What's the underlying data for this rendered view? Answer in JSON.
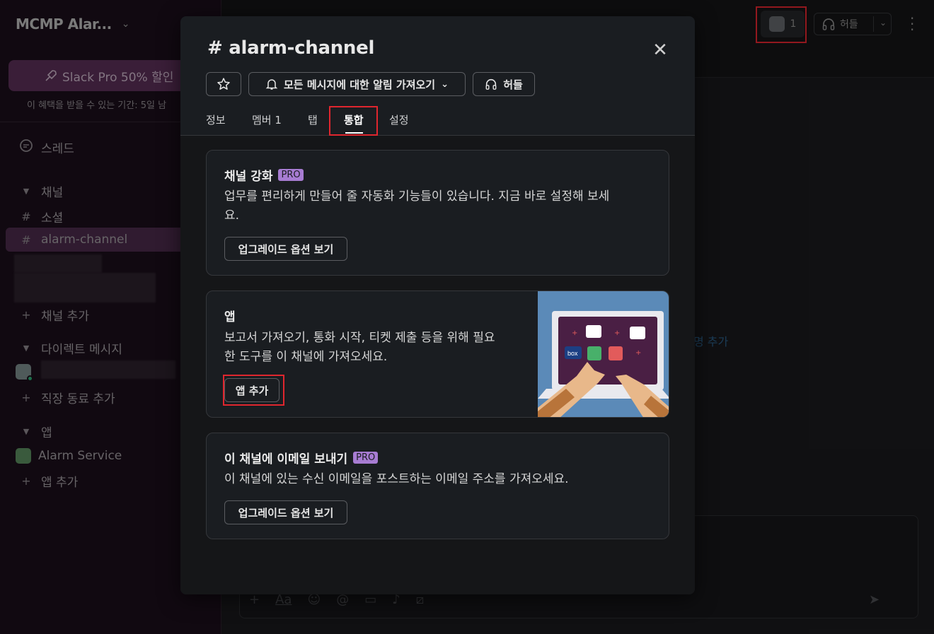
{
  "workspace": {
    "name": "MCMP Alar...",
    "chevron_icon": "chevron-down-icon"
  },
  "sidebar": {
    "promo_label": "Slack Pro 50% 할인",
    "promo_sub": "이 혜택을 받을 수 있는 기간: 5일 남",
    "threads_label": "스레드",
    "channels_header": "채널",
    "channels": [
      {
        "label": "소셜",
        "active": false
      },
      {
        "label": "alarm-channel",
        "active": true
      }
    ],
    "add_channel": "채널 추가",
    "dm_header": "다이렉트 메시지",
    "add_coworker": "직장 동료 추가",
    "apps_header": "앱",
    "apps": [
      {
        "label": "Alarm Service"
      }
    ],
    "add_app": "앱 추가"
  },
  "topbar": {
    "member_count": "1",
    "huddle_label": "허들"
  },
  "background": {
    "partial_link": "명 추가"
  },
  "modal": {
    "title": "alarm-channel",
    "star_icon": "star-icon",
    "notify_label": "모든 메시지에 대한 알림 가져오기",
    "huddle_label": "허들",
    "tabs": [
      {
        "label": "정보"
      },
      {
        "label": "멤버",
        "count": "1"
      },
      {
        "label": "탭"
      },
      {
        "label": "통합",
        "active": true
      },
      {
        "label": "설정"
      }
    ],
    "cards": {
      "workflow": {
        "title": "채널 강화",
        "badge": "PRO",
        "desc_line1": "업무를 편리하게 만들어 줄 자동화 기능들이 있습니다. 지금 바로 설정해 보세",
        "desc_line2": "요.",
        "button": "업그레이드 옵션 보기"
      },
      "apps": {
        "title": "앱",
        "desc_line1": "보고서 가져오기, 통화 시작, 티켓 제출 등을 위해 필요",
        "desc_line2": "한 도구를 이 채널에 가져오세요.",
        "button": "앱 추가",
        "illustration_tile_text": "box"
      },
      "email": {
        "title": "이 채널에 이메일 보내기",
        "badge": "PRO",
        "desc": "이 채널에 있는 수신 이메일을 포스트하는 이메일 주소를 가져오세요.",
        "button": "업그레이드 옵션 보기"
      }
    }
  },
  "colors": {
    "highlight": "#e0262e",
    "pro_badge": "#a77cd2",
    "sidebar_bg": "#1b0f1b",
    "modal_bg": "#1a1d21"
  }
}
